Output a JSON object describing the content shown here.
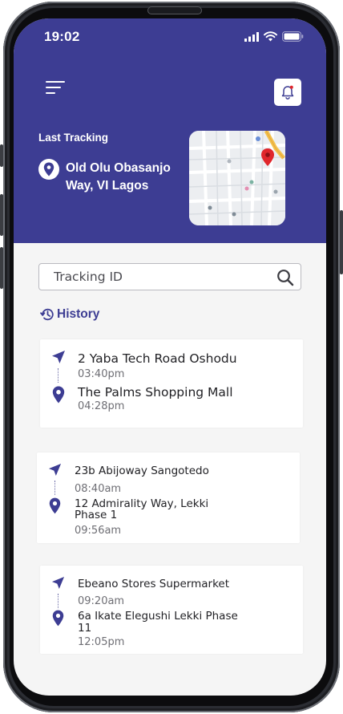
{
  "status_bar": {
    "time": "19:02"
  },
  "header": {
    "last_tracking_label": "Last Tracking",
    "location_line1": "Old Olu Obasanjo",
    "location_line2": "Way, VI Lagos"
  },
  "search": {
    "placeholder": "Tracking ID"
  },
  "history": {
    "label": "History",
    "items": [
      {
        "from": "2 Yaba Tech Road Oshodu",
        "from_time": "03:40pm",
        "to": "The Palms Shopping Mall",
        "to_time": "04:28pm"
      },
      {
        "from": "23b Abijoway Sangotedo",
        "from_time": "08:40am",
        "to_line1": "12 Admirality Way, Lekki",
        "to_line2": "Phase 1",
        "to_time": "09:56am"
      },
      {
        "from": "Ebeano Stores Supermarket",
        "from_time": "09:20am",
        "to_line1": "6a Ikate Elegushi Lekki Phase",
        "to_line2": "11",
        "to_time": "12:05pm"
      }
    ]
  },
  "colors": {
    "primary": "#3d3d93",
    "background": "#f5f5f5",
    "map_pin": "#e0262b"
  },
  "icons": {
    "menu": "menu-icon",
    "bell": "bell-icon",
    "location": "location-pin-icon",
    "search": "search-icon",
    "history": "history-icon",
    "send": "send-icon"
  }
}
